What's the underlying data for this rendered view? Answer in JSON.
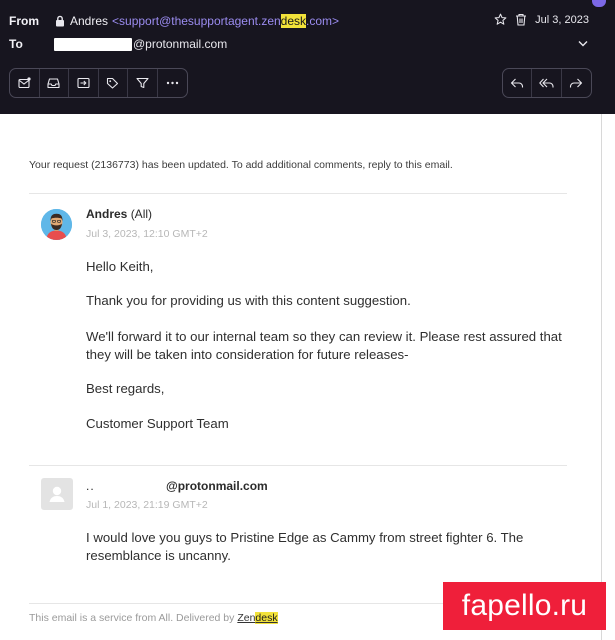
{
  "header": {
    "from_label": "From",
    "sender_name": "Andres",
    "sender_email_prefix": "<support@thesupportagent.zen",
    "sender_email_highlight": "desk",
    "sender_email_suffix": ".com>",
    "to_label": "To",
    "to_email_visible": "@protonmail.com",
    "date": "Jul 3, 2023"
  },
  "toolbar_left": [
    "mark-unread-icon",
    "inbox-icon",
    "move-icon",
    "label-icon",
    "filter-icon",
    "more-icon"
  ],
  "toolbar_right": [
    "reply-icon",
    "reply-all-icon",
    "forward-icon"
  ],
  "email": {
    "intro": "Your request (2136773) has been updated. To add additional comments, reply to this email.",
    "comment1": {
      "author": "Andres",
      "author_org": "(All)",
      "date": "Jul 3, 2023, 12:10 GMT+2",
      "paragraphs": [
        "Hello Keith,",
        "Thank you for providing us with this content suggestion.",
        "We'll forward it to our internal team so they can review it. Please rest assured that they will be taken into consideration for future releases-",
        "Best regards,",
        "Customer Support Team"
      ]
    },
    "comment2": {
      "author_prefix": "..",
      "author_email": "@protonmail.com",
      "date": "Jul 1, 2023, 21:19 GMT+2",
      "paragraph": "I would love you guys to Pristine Edge as Cammy from street fighter 6. The resemblance is uncanny."
    },
    "footer_text": "This email is a service from All. Delivered by ",
    "footer_link_prefix": "Zen",
    "footer_link_highlight": "desk"
  },
  "watermark": "fapello.ru",
  "colors": {
    "header_bg": "#17151f",
    "link_purple": "#9b8cf0",
    "highlight": "#f2e23a",
    "watermark_bg": "#ef1f3a"
  }
}
